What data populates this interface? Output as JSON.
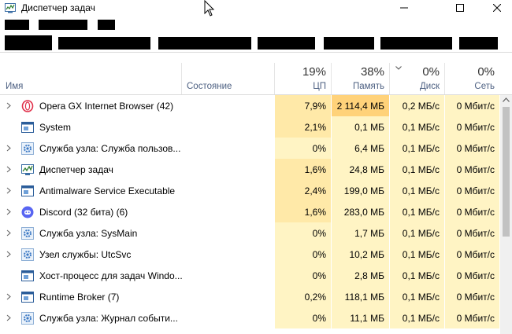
{
  "window": {
    "title": "Диспетчер задач",
    "icon": "task-manager-icon"
  },
  "controls": [
    "minimize-icon",
    "maximize-icon",
    "close-icon"
  ],
  "colors": {
    "cpu_light": "#fff4c4",
    "cpu_heavy": "#ffe9a8",
    "mem_hot": "#ffd27a",
    "header_label": "#4d6082"
  },
  "columns": {
    "name": "Имя",
    "status": "Состояние",
    "cpu": {
      "percent": "19%",
      "label": "ЦП"
    },
    "memory": {
      "percent": "38%",
      "label": "Память"
    },
    "disk": {
      "percent": "0%",
      "label": "Диск"
    },
    "network": {
      "percent": "0%",
      "label": "Сеть"
    }
  },
  "processes": [
    {
      "name": "Opera GX Internet Browser (42)",
      "icon": "opera-gx-icon",
      "expandable": true,
      "cpu": "7,9%",
      "memory": "2 114,4 МБ",
      "disk": "0,2 МБ/с",
      "network": "0 Мбит/с"
    },
    {
      "name": "System",
      "icon": "system-window-icon",
      "expandable": false,
      "cpu": "2,1%",
      "memory": "0,1 МБ",
      "disk": "0,1 МБ/с",
      "network": "0 Мбит/с"
    },
    {
      "name": "Служба узла: Служба пользов...",
      "icon": "service-gear-icon",
      "expandable": true,
      "cpu": "0%",
      "memory": "6,4 МБ",
      "disk": "0,1 МБ/с",
      "network": "0 Мбит/с"
    },
    {
      "name": "Диспетчер задач",
      "icon": "task-manager-icon",
      "expandable": true,
      "cpu": "1,6%",
      "memory": "24,8 МБ",
      "disk": "0,1 МБ/с",
      "network": "0 Мбит/с"
    },
    {
      "name": "Antimalware Service Executable",
      "icon": "system-window-icon",
      "expandable": true,
      "cpu": "2,4%",
      "memory": "199,0 МБ",
      "disk": "0,1 МБ/с",
      "network": "0 Мбит/с"
    },
    {
      "name": "Discord (32 бита) (6)",
      "icon": "discord-icon",
      "expandable": true,
      "cpu": "1,6%",
      "memory": "283,0 МБ",
      "disk": "0,1 МБ/с",
      "network": "0 Мбит/с"
    },
    {
      "name": "Служба узла: SysMain",
      "icon": "service-gear-icon",
      "expandable": true,
      "cpu": "0%",
      "memory": "1,7 МБ",
      "disk": "0,1 МБ/с",
      "network": "0 Мбит/с"
    },
    {
      "name": "Узел службы: UtcSvc",
      "icon": "service-gear-icon",
      "expandable": true,
      "cpu": "0%",
      "memory": "10,2 МБ",
      "disk": "0,1 МБ/с",
      "network": "0 Мбит/с"
    },
    {
      "name": "Хост-процесс для задач Windo...",
      "icon": "system-window-icon",
      "expandable": false,
      "cpu": "0%",
      "memory": "2,8 МБ",
      "disk": "0,1 МБ/с",
      "network": "0 Мбит/с"
    },
    {
      "name": "Runtime Broker (7)",
      "icon": "system-window-icon",
      "expandable": true,
      "cpu": "0,2%",
      "memory": "118,1 МБ",
      "disk": "0,1 МБ/с",
      "network": "0 Мбит/с"
    },
    {
      "name": "Служба узла: Журнал событи...",
      "icon": "service-gear-icon",
      "expandable": true,
      "cpu": "0%",
      "memory": "11,1 МБ",
      "disk": "0,1 МБ/с",
      "network": "0 Мбит/с"
    }
  ]
}
